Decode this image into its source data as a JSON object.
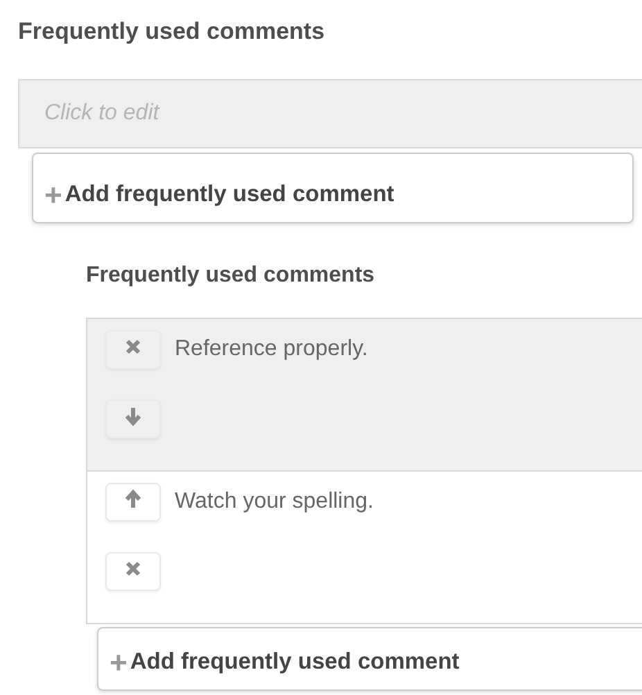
{
  "heading": "Frequently used comments",
  "field": {
    "placeholder": "Click to edit"
  },
  "add_button": {
    "icon": "+",
    "label": "Add frequently used comment"
  },
  "list": {
    "heading": "Frequently used comments",
    "items": [
      {
        "text": "Reference properly.",
        "highlighted": true,
        "actions": [
          {
            "kind": "delete"
          },
          {
            "kind": "down"
          }
        ]
      },
      {
        "text": "Watch your spelling.",
        "highlighted": false,
        "actions": [
          {
            "kind": "up"
          },
          {
            "kind": "delete"
          }
        ]
      }
    ],
    "add_button": {
      "icon": "+",
      "label": "Add frequently used comment"
    }
  }
}
